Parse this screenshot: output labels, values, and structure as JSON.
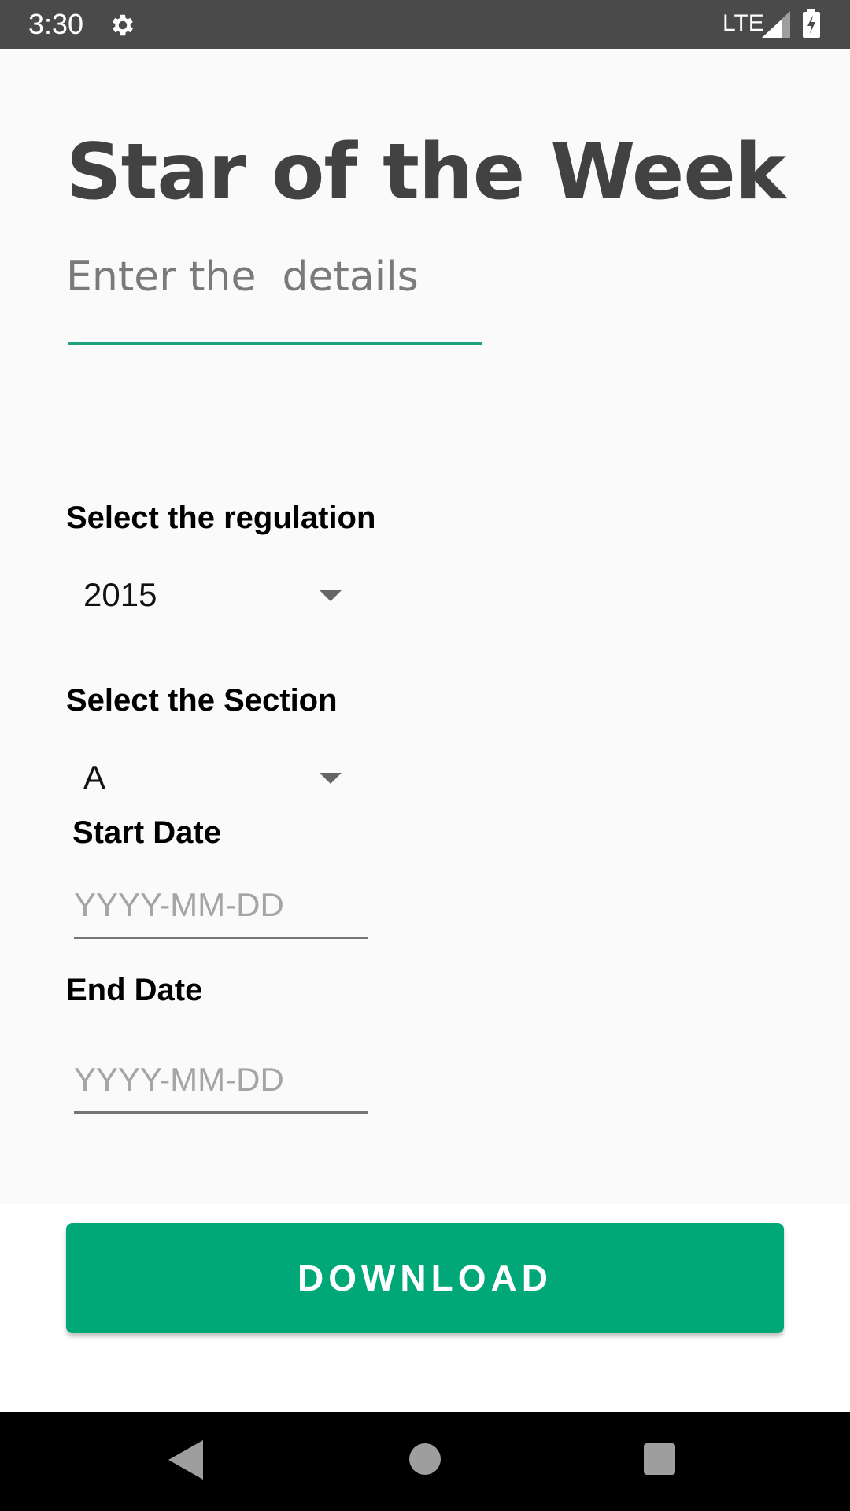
{
  "status_bar": {
    "time": "3:30",
    "network": "LTE",
    "icons": [
      "gear-icon",
      "signal-icon",
      "battery-charging-icon"
    ]
  },
  "header": {
    "title": "Star of the Week",
    "subtitle": "Enter the  details"
  },
  "form": {
    "regulation": {
      "label": "Select the regulation",
      "value": "2015"
    },
    "section": {
      "label": "Select the Section",
      "value": "A"
    },
    "start_date": {
      "label": "Start Date",
      "placeholder": "YYYY-MM-DD",
      "value": ""
    },
    "end_date": {
      "label": "End Date",
      "placeholder": "YYYY-MM-DD",
      "value": ""
    }
  },
  "actions": {
    "download_label": "DOWNLOAD"
  },
  "colors": {
    "accent": "#00a878",
    "underline": "#1ea37e",
    "status_bar": "#4a4a4a",
    "title_text": "#424242"
  },
  "nav_bar": {
    "icons": [
      "back-icon",
      "home-icon",
      "recent-apps-icon"
    ]
  }
}
